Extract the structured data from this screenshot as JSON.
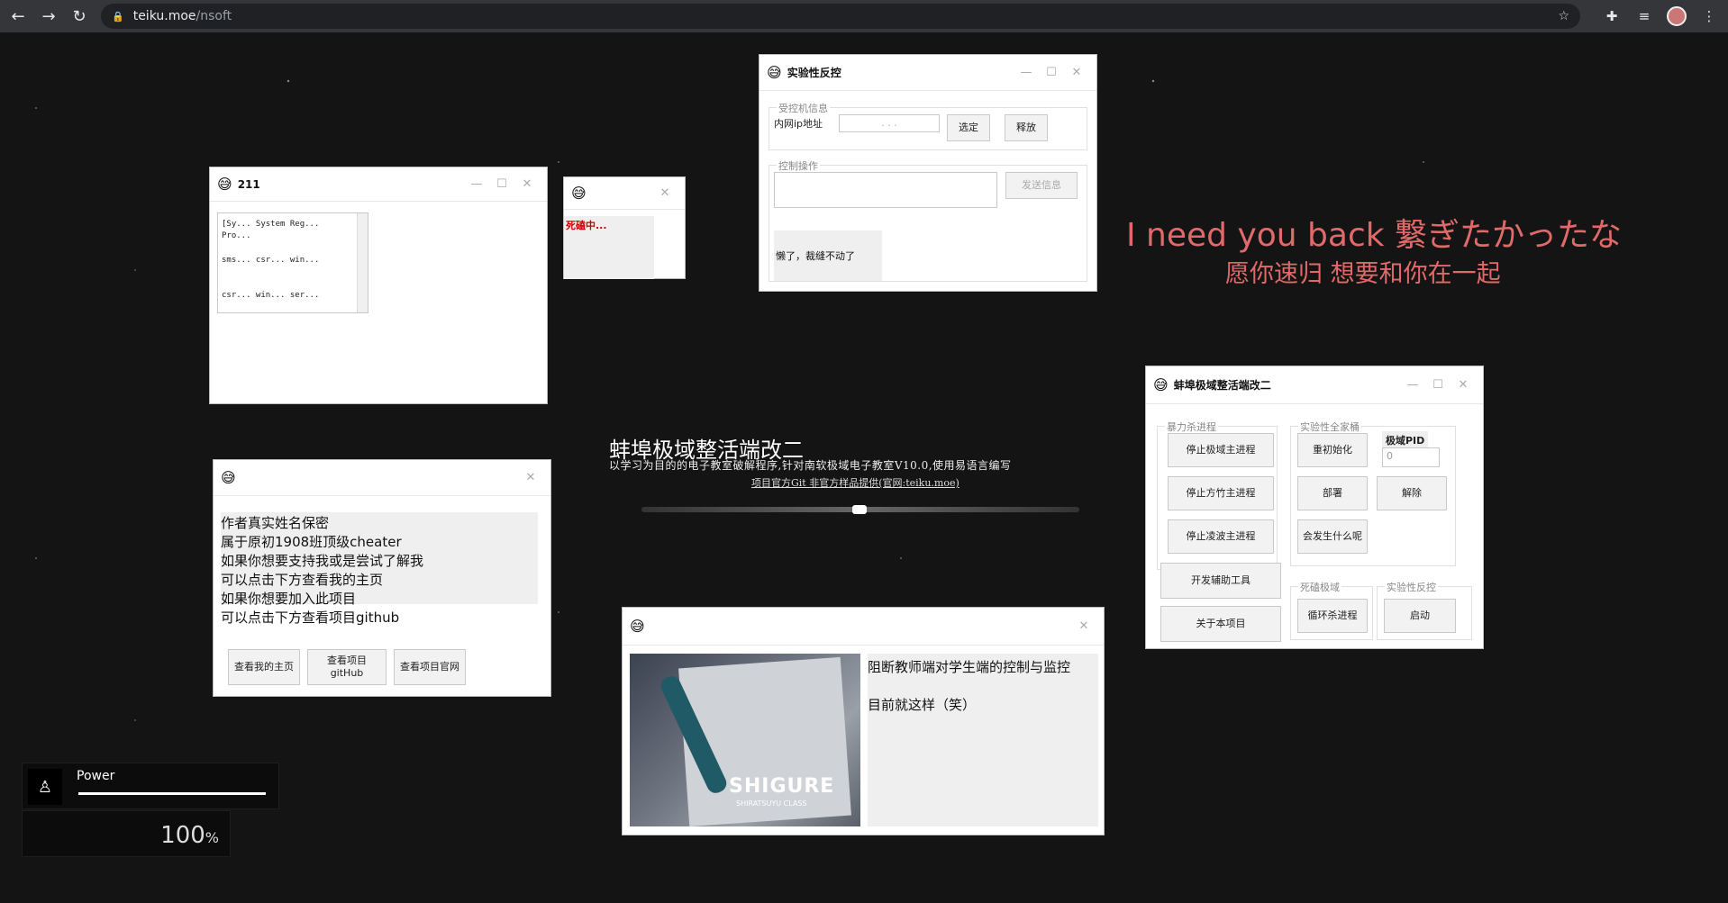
{
  "browser": {
    "url_host": "teiku.moe",
    "url_path": "/nsoft"
  },
  "win211": {
    "title": "211",
    "list": [
      "[Sy... System Reg...",
      "Pro...",
      "sms... csr... win...",
      "csr... win... ser..."
    ]
  },
  "winDying": {
    "text": "死磕中..."
  },
  "winControl": {
    "title": "实验性反控",
    "group1": "受控机信息",
    "ip_label": "内网ip地址",
    "ip_value": ".     .     .",
    "select_btn": "选定",
    "release_btn": "释放",
    "group2": "控制操作",
    "send_btn": "发送信息",
    "status": "懒了，裁缝不动了"
  },
  "lyrics": {
    "line1": "I need you back 繋ぎたかったな",
    "line2": "愿你速归 想要和你在一起"
  },
  "center": {
    "title": "蚌埠极域整活端改二",
    "subtitle": "以学习为目的的电子教室破解程序,针对南软极域电子教室V10.0,使用易语言编写",
    "link": "项目官方Git 非官方样品提供(官网:teiku.moe)"
  },
  "winMain": {
    "title": "蚌埠极域整活端改二",
    "group_kill": "暴力杀进程",
    "btn_stop_jiyu": "停止极域主进程",
    "btn_stop_fangzhu": "停止方竹主进程",
    "btn_stop_lingbo": "停止凌波主进程",
    "group_exp": "实验性全家桶",
    "btn_reinit": "重初始化",
    "pid_label": "极域PID",
    "pid_value": "0",
    "btn_deploy": "部署",
    "btn_remove": "解除",
    "btn_what": "会发生什么呢",
    "btn_devtools": "开发辅助工具",
    "btn_about": "关于本项目",
    "group_dead": "死磕极域",
    "btn_loop_kill": "循环杀进程",
    "group_control": "实验性反控",
    "btn_start": "启动"
  },
  "winAuthor": {
    "lines": [
      "作者真实姓名保密",
      "属于原初1908班顶级cheater",
      "如果你想要支持我或是尝试了解我",
      "可以点击下方查看我的主页",
      "如果你想要加入此项目",
      "可以点击下方查看项目github"
    ],
    "btn_home": "查看我的主页",
    "btn_github_1": "查看项目",
    "btn_github_2": "gitHub",
    "btn_site": "查看项目官网"
  },
  "winImage": {
    "brand": "SHIGURE",
    "brand_sub": "SHIRATSUYU CLASS",
    "text1": "阻断教师端对学生端的控制与监控",
    "text2": "目前就这样（笑）"
  },
  "power": {
    "label": "Power",
    "percent": "100",
    "unit": "%"
  }
}
